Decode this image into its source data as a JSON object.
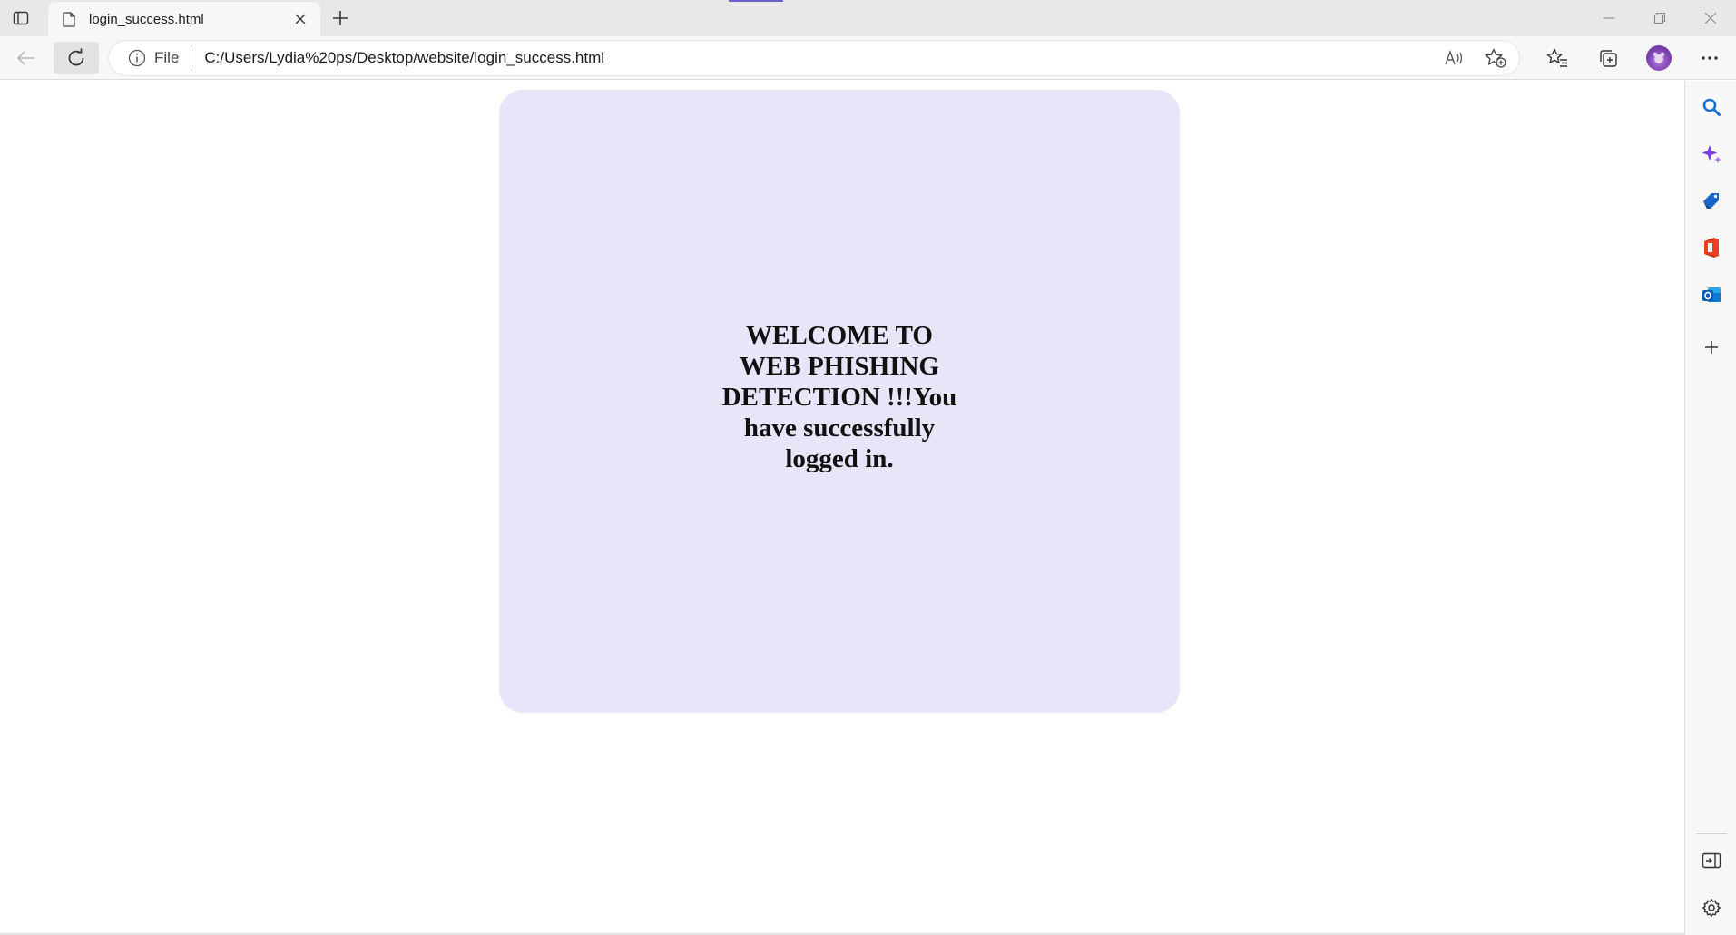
{
  "browser": {
    "tab": {
      "title": "login_success.html"
    },
    "address": {
      "scheme_label": "File",
      "url": "C:/Users/Lydia%20ps/Desktop/website/login_success.html"
    },
    "accent_color": "#6b63c9"
  },
  "page": {
    "message": "WELCOME TO WEB PHISHING DETECTION !!!You have successfully logged in.",
    "card_color": "#e6e6f8"
  },
  "sidebar": {
    "items": [
      "search-icon",
      "copilot-icon",
      "shopping-tag-icon",
      "office-icon",
      "outlook-icon",
      "add-icon"
    ],
    "bottom_items": [
      "hide-sidebar-icon",
      "settings-icon"
    ]
  }
}
